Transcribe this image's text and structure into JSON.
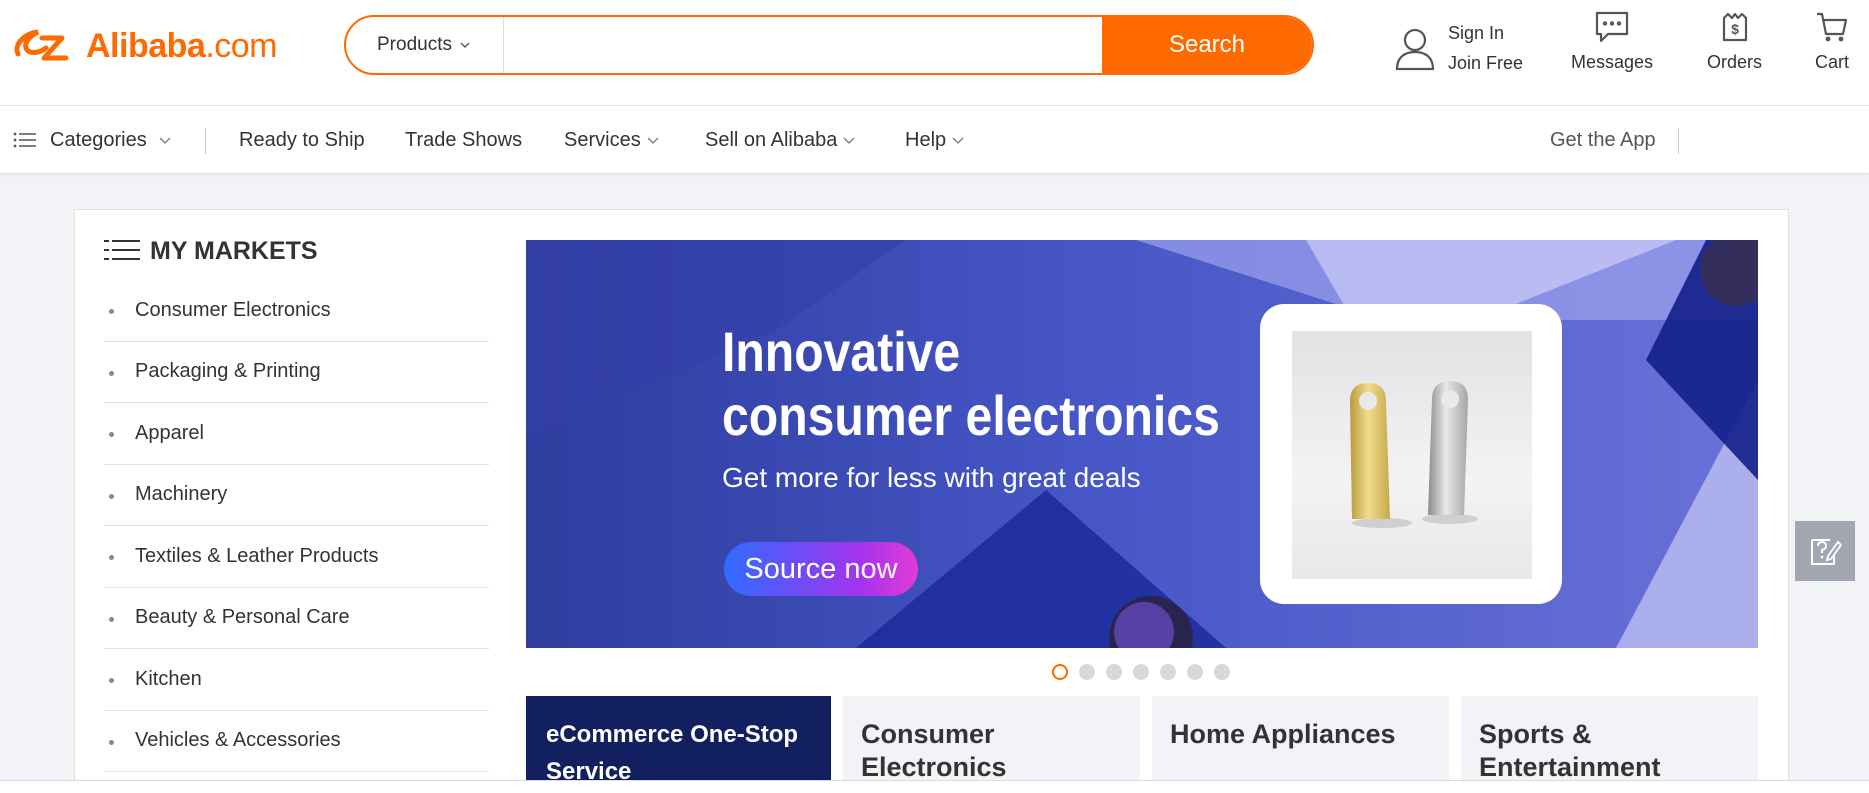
{
  "header": {
    "logo_main": "Alibaba",
    "logo_suffix": ".com",
    "search": {
      "category": "Products",
      "placeholder": "",
      "button_label": "Search"
    },
    "account": {
      "sign_in": "Sign In",
      "join_free": "Join Free"
    },
    "messages_label": "Messages",
    "orders_label": "Orders",
    "cart_label": "Cart"
  },
  "nav": {
    "categories": "Categories",
    "ready_to_ship": "Ready to Ship",
    "trade_shows": "Trade Shows",
    "services": "Services",
    "sell": "Sell on Alibaba",
    "help": "Help",
    "get_app": "Get the App"
  },
  "markets": {
    "title": "MY MARKETS",
    "items": [
      "Consumer Electronics",
      "Packaging & Printing",
      "Apparel",
      "Machinery",
      "Textiles & Leather Products",
      "Beauty & Personal Care",
      "Kitchen",
      "Vehicles & Accessories"
    ]
  },
  "banner": {
    "headline_1": "Innovative",
    "headline_2": "consumer electronics",
    "subline": "Get more for less with great deals",
    "cta": "Source now",
    "slide_count": 7,
    "active_slide": 1
  },
  "tiles": [
    {
      "label": "eCommerce One-Stop Service"
    },
    {
      "label": "Consumer Electronics"
    },
    {
      "label": "Home Appliances"
    },
    {
      "label": "Sports & Entertainment"
    }
  ],
  "colors": {
    "brand": "#ff6a00",
    "banner_bg": "#3d4cb0",
    "tile_dark": "#13205f"
  }
}
